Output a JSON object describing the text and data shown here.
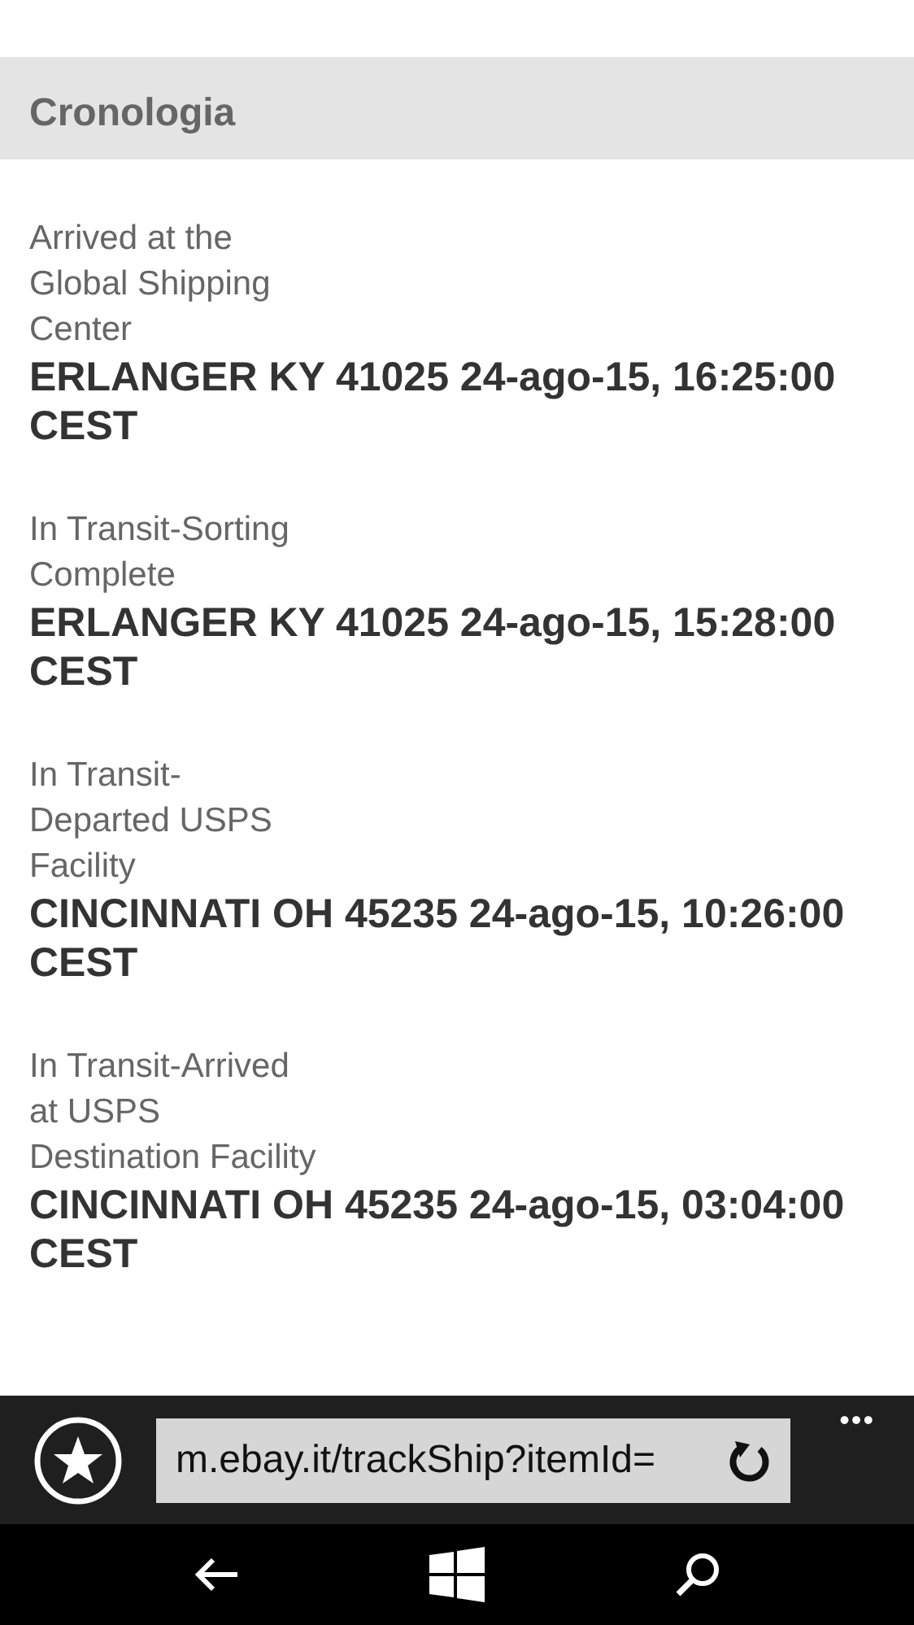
{
  "section_title": "Cronologia",
  "events": [
    {
      "status": "Arrived at the Global Shipping Center",
      "location_time": "ERLANGER KY 41025 24-ago-15, 16:25:00 CEST"
    },
    {
      "status": "In Transit-Sorting Complete",
      "location_time": "ERLANGER KY 41025 24-ago-15, 15:28:00 CEST"
    },
    {
      "status": "In Transit-Departed USPS Facility",
      "location_time": "CINCINNATI OH 45235 24-ago-15, 10:26:00 CEST"
    },
    {
      "status": "In Transit-Arrived at USPS Destination Facility",
      "location_time": "CINCINNATI OH 45235 24-ago-15, 03:04:00 CEST"
    }
  ],
  "address_bar": {
    "url": "m.ebay.it/trackShip?itemId=",
    "more": "•••"
  }
}
